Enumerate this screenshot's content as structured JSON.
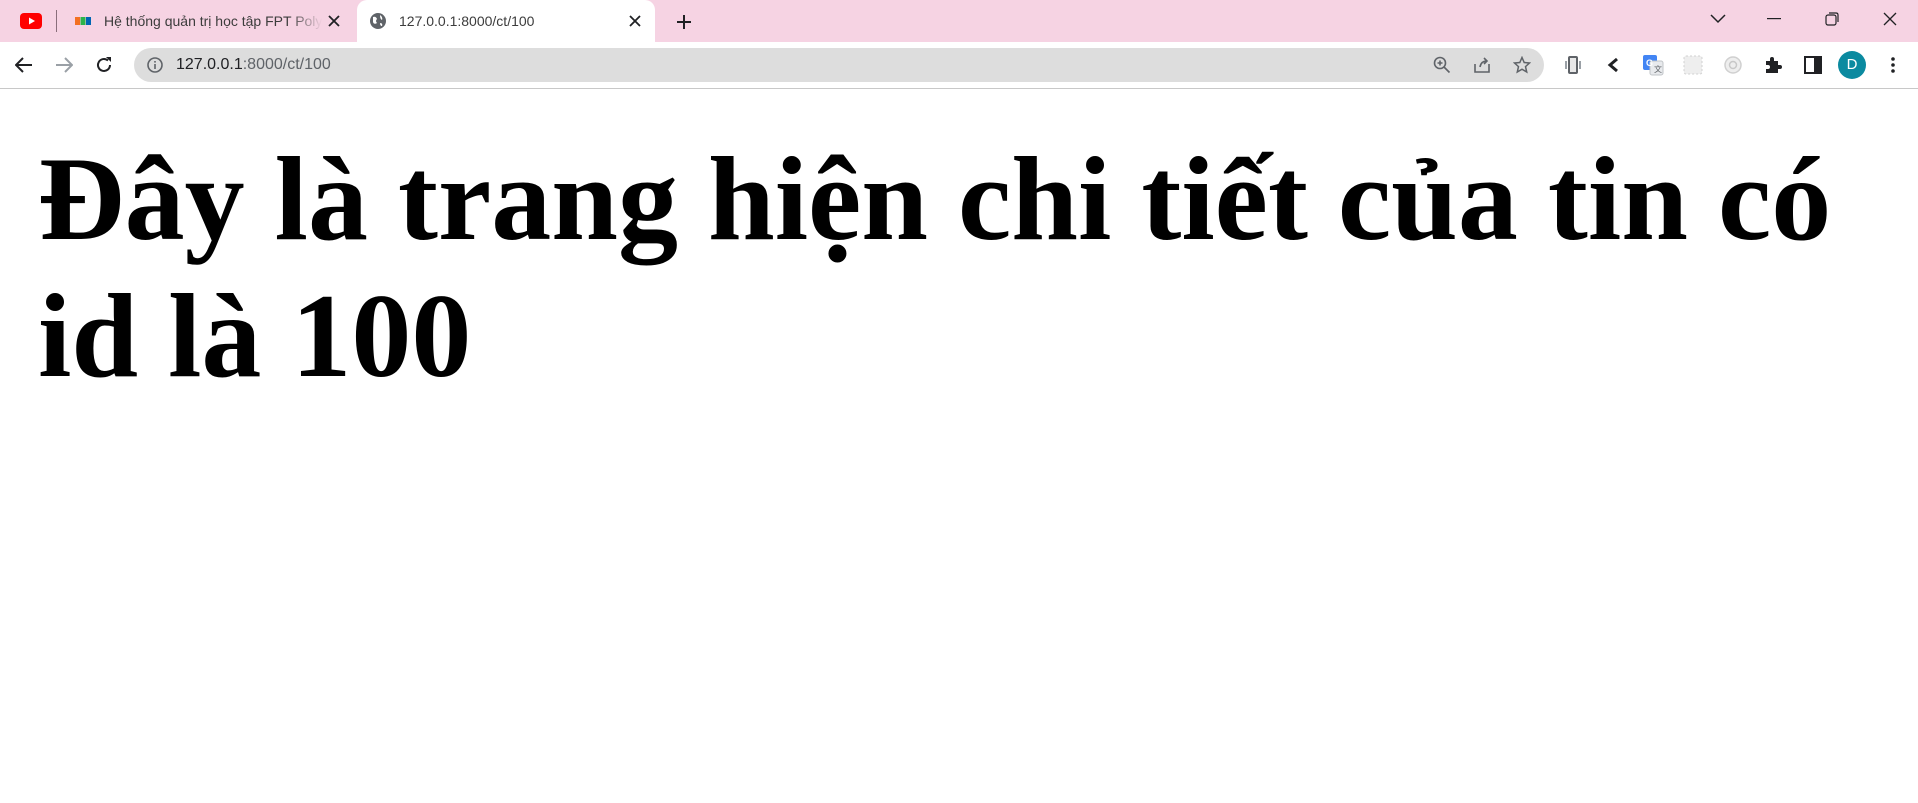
{
  "browser": {
    "tabs": [
      {
        "title": "Hệ thống quản trị học tập FPT Polytechnic",
        "active": false
      },
      {
        "title": "127.0.0.1:8000/ct/100",
        "active": true
      }
    ],
    "address_bar": {
      "host": "127.0.0.1",
      "path": ":8000/ct/100"
    },
    "profile_initial": "D",
    "colors": {
      "tabstrip_bg": "#f6d3e3",
      "omnibox_bg": "#dddddd",
      "avatar_bg": "#0b8aa0",
      "youtube_red": "#ff0000"
    },
    "icons": [
      "youtube-icon",
      "fpt-icon",
      "globe-icon",
      "close-icon",
      "plus-icon",
      "chevron-down-icon",
      "minimize-icon",
      "restore-icon",
      "back-icon",
      "forward-icon",
      "reload-icon",
      "info-icon",
      "zoom-icon",
      "share-icon",
      "star-icon",
      "google-translate-icon",
      "puzzle-icon",
      "side-panel-icon",
      "menu-icon"
    ]
  },
  "page": {
    "heading": "Đây là trang hiện chi tiết của tin có id là 100"
  }
}
